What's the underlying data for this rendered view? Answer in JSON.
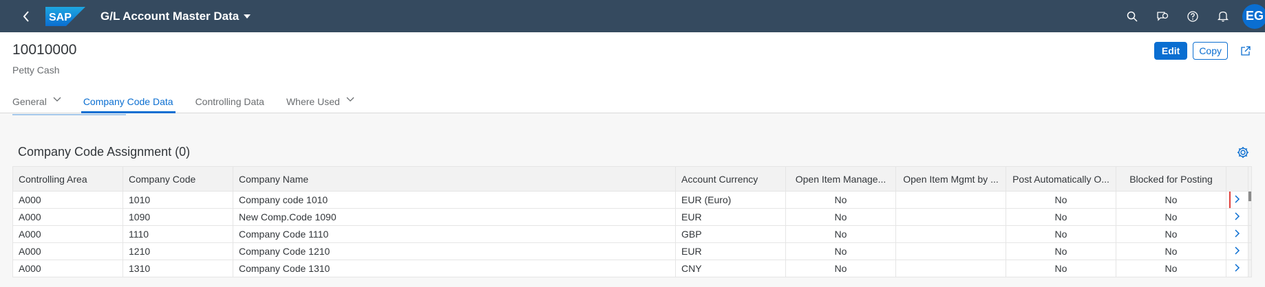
{
  "shell": {
    "logo_text": "SAP",
    "app_title": "G/L Account Master Data",
    "avatar_initials": "EG",
    "icons": [
      "back-icon",
      "search-icon",
      "feedback-icon",
      "help-icon",
      "notifications-icon"
    ]
  },
  "header": {
    "title": "10010000",
    "subtitle": "Petty Cash",
    "edit_label": "Edit",
    "copy_label": "Copy",
    "tabs": [
      {
        "label": "General",
        "has_menu": true
      },
      {
        "label": "Company Code Data",
        "active": true
      },
      {
        "label": "Controlling Data"
      },
      {
        "label": "Where Used",
        "has_menu": true
      }
    ]
  },
  "section": {
    "title": "Company Code Assignment (0)"
  },
  "table": {
    "columns": [
      "Controlling Area",
      "Company Code",
      "Company Name",
      "Account Currency",
      "Open Item Manage...",
      "Open Item Mgmt by ...",
      "Post Automatically O...",
      "Blocked for Posting"
    ],
    "rows": [
      [
        "A000",
        "1010",
        "Company code 1010",
        "EUR (Euro)",
        "No",
        "",
        "No",
        "No"
      ],
      [
        "A000",
        "1090",
        "New Comp.Code 1090",
        "EUR",
        "No",
        "",
        "No",
        "No"
      ],
      [
        "A000",
        "1110",
        "Company Code 1110",
        "GBP",
        "No",
        "",
        "No",
        "No"
      ],
      [
        "A000",
        "1210",
        "Company Code 1210",
        "EUR",
        "No",
        "",
        "No",
        "No"
      ],
      [
        "A000",
        "1310",
        "Company Code 1310",
        "CNY",
        "No",
        "",
        "No",
        "No"
      ]
    ]
  },
  "colors": {
    "shell_bg": "#354a5f",
    "accent": "#0a6ed1",
    "highlight": "#e0403b"
  }
}
